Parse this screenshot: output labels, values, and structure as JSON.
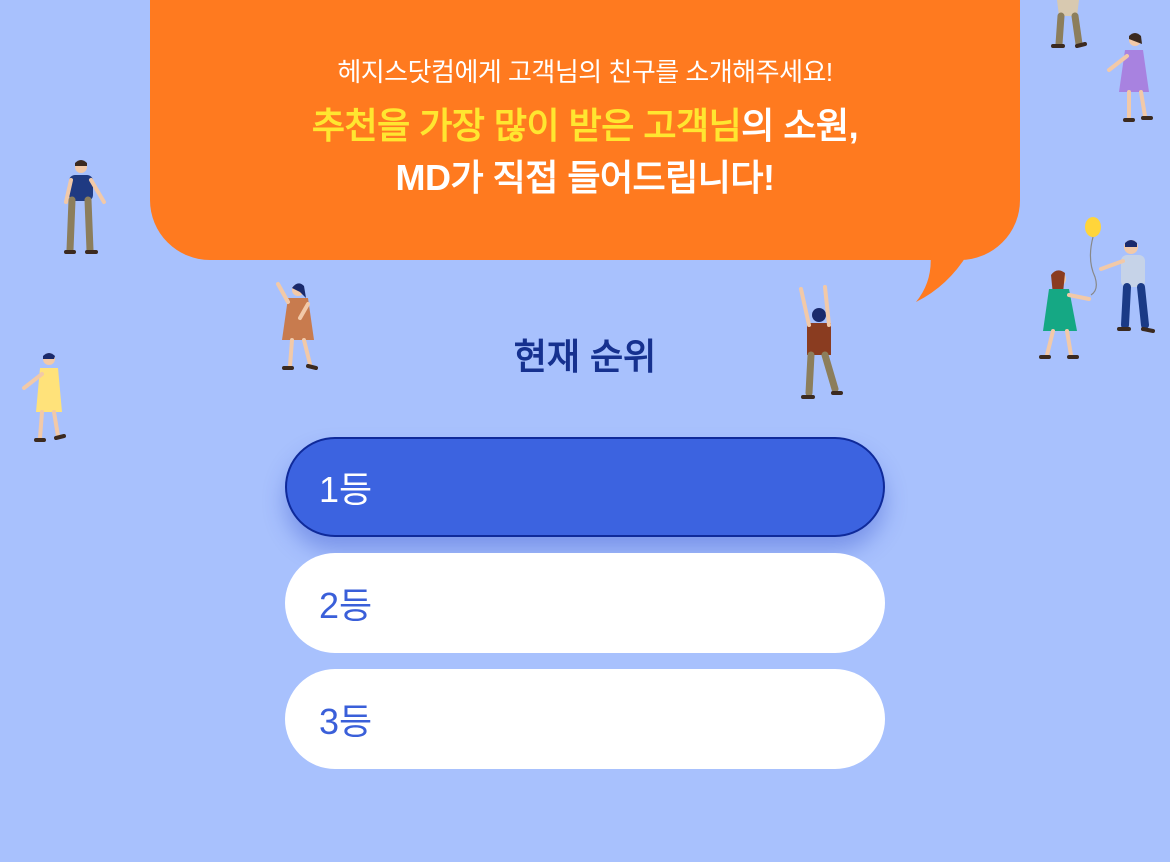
{
  "banner": {
    "intro": "헤지스닷컴에게 고객님의 친구를 소개해주세요!",
    "headline_highlight": "추천을 가장 많이 받은 고객님",
    "headline_rest": "의 소원,",
    "headline_line2": "MD가 직접 들어드립니다!",
    "colors": {
      "bubble": "#ff7a1f",
      "highlight": "#ffe630"
    }
  },
  "ranking": {
    "title": "현재 순위",
    "items": [
      {
        "label": "1등",
        "selected": true
      },
      {
        "label": "2등",
        "selected": false
      },
      {
        "label": "3등",
        "selected": false
      }
    ],
    "colors": {
      "selected_bg": "#3c63e0",
      "item_text": "#3a5fd9",
      "title": "#16318f"
    }
  },
  "page": {
    "background": "#a8c1fd"
  },
  "illustrations": [
    "person-blue-shirt-icon",
    "person-yellow-dress-icon",
    "person-orange-dress-waving-icon",
    "person-cheering-icon",
    "person-walking-top-icon",
    "person-purple-dress-icon",
    "couple-with-balloon-icon"
  ]
}
